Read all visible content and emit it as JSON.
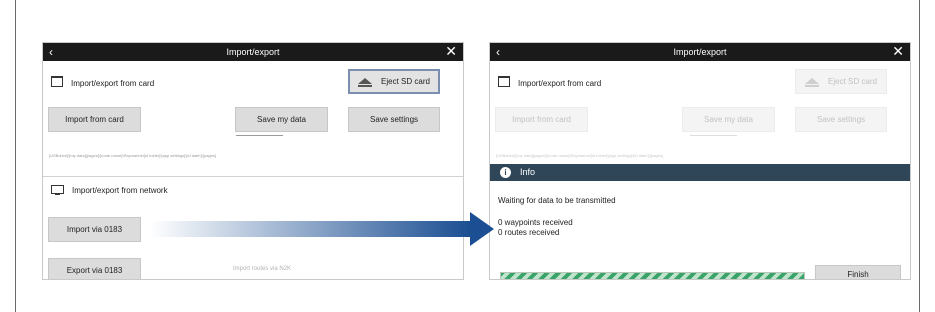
{
  "colors": {
    "titlebar": "#1a1a1a",
    "info_bar": "#2f4658",
    "arrow": "#1b4e92",
    "progress": "#3aa36a"
  },
  "left_screen": {
    "back_icon": "chevron-left-icon",
    "close_icon": "close-x-icon",
    "title": "Import/export",
    "card_section": {
      "icon": "sd-card-icon",
      "label": "Import/export from card"
    },
    "eject_button": {
      "icon": "eject-icon",
      "label": "Eject SD card"
    },
    "import_card_button": "Import from card",
    "save_data_button": "Save my data",
    "save_settings_button": "Save settings",
    "path_text": "[USBdrive]\\[my data][pages]\\[route name]\\Raymarine\\[ld folder]\\[app settings]\\[ld date\\]\\[pages]",
    "network_section": {
      "icon": "monitor-icon",
      "label": "Import/export from network"
    },
    "import_network_button": "Import via 0183",
    "export_network_button": "Export via 0183",
    "network_status": "Import routes via N2K"
  },
  "right_screen": {
    "back_icon": "chevron-left-icon",
    "close_icon": "close-x-icon",
    "title": "Import/export",
    "card_section": {
      "icon": "sd-card-icon",
      "label": "Import/export from card"
    },
    "eject_button": {
      "icon": "eject-icon",
      "label": "Eject SD card"
    },
    "import_card_button": "Import from card",
    "save_data_button": "Save my data",
    "save_settings_button": "Save settings",
    "path_text": "[USBdrive]\\[my data][pages]\\[route name]\\Raymarine\\[ld folder]\\[app settings]\\[ld date\\]\\[pages]",
    "info": {
      "icon": "info-icon",
      "title": "Info",
      "waiting_text": "Waiting for data to be transmitted",
      "waypoints_text": "0 waypoints received",
      "routes_text": "0 routes received",
      "progress": 1.0,
      "finish_button": "Finish"
    }
  },
  "arrow": {
    "icon": "right-arrow-icon"
  }
}
